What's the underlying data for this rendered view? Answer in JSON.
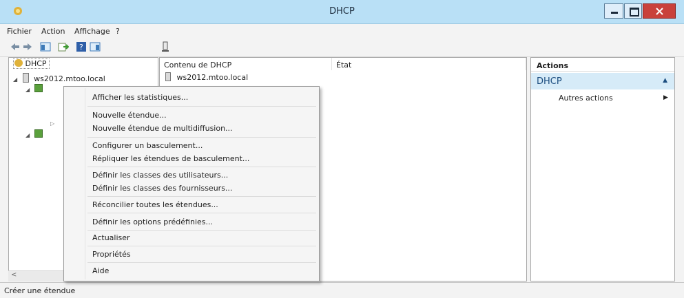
{
  "window": {
    "title": "DHCP"
  },
  "menu": [
    "Fichier",
    "Action",
    "Affichage",
    "?"
  ],
  "tree": {
    "root": "DHCP",
    "server": "ws2012.mtoo.local"
  },
  "list": {
    "columns": [
      "Contenu de DHCP",
      "État"
    ],
    "rows": [
      "ws2012.mtoo.local"
    ]
  },
  "actions": {
    "header": "Actions",
    "section": "DHCP",
    "items": [
      "Autres actions"
    ]
  },
  "context_menu": [
    "Afficher les statistiques...",
    "Nouvelle étendue...",
    "Nouvelle étendue de multidiffusion...",
    "Configurer un basculement...",
    "Répliquer les étendues de basculement...",
    "Définir les classes des utilisateurs...",
    "Définir les classes des fournisseurs...",
    "Réconcilier toutes les étendues...",
    "Définir les options prédéfinies...",
    "Actualiser",
    "Propriétés",
    "Aide"
  ],
  "status": "Créer une étendue",
  "colors": {
    "title_bar": "#b9e0f6",
    "close_button": "#c9413b",
    "action_section": "#d6ebf8"
  }
}
